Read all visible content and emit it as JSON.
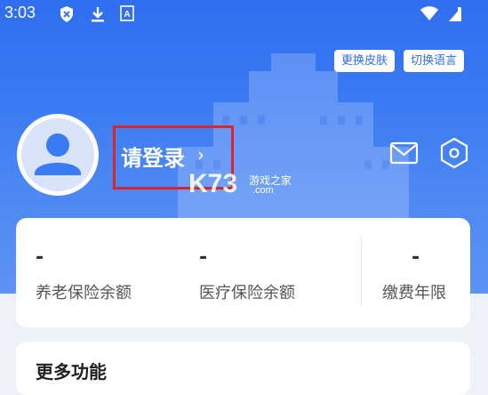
{
  "status_bar": {
    "time": "3:03",
    "icons": [
      "shield-x-icon",
      "download-icon",
      "a-box-icon",
      "wifi-icon",
      "battery-icon"
    ]
  },
  "header": {
    "skin_button": "更换皮肤",
    "language_button": "切换语言",
    "login_label": "请登录",
    "chevron": "›",
    "icons": [
      "avatar-user-icon",
      "mail-icon",
      "settings-icon"
    ],
    "background_color": "#2f6ff0"
  },
  "watermark": {
    "brand": "K73",
    "site": "游戏之家",
    "domain": ".com"
  },
  "stats": [
    {
      "value": "-",
      "label": "养老保险余额"
    },
    {
      "value": "-",
      "label": "医疗保险余额"
    },
    {
      "value": "-",
      "label": "缴费年限"
    }
  ],
  "more": {
    "title": "更多功能"
  },
  "annotation": {
    "box_color": "#d9262b"
  }
}
